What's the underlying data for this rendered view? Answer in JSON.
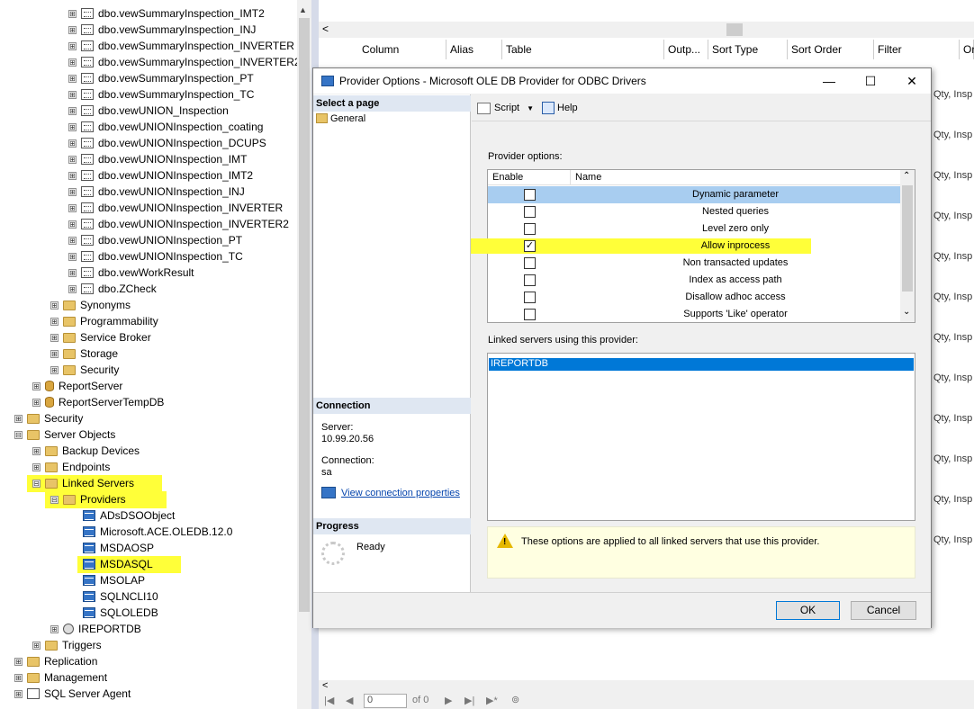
{
  "tree": {
    "views": [
      "dbo.vewSummaryInspection_IMT2",
      "dbo.vewSummaryInspection_INJ",
      "dbo.vewSummaryInspection_INVERTER",
      "dbo.vewSummaryInspection_INVERTER2",
      "dbo.vewSummaryInspection_PT",
      "dbo.vewSummaryInspection_TC",
      "dbo.vewUNION_Inspection",
      "dbo.vewUNIONInspection_coating",
      "dbo.vewUNIONInspection_DCUPS",
      "dbo.vewUNIONInspection_IMT",
      "dbo.vewUNIONInspection_IMT2",
      "dbo.vewUNIONInspection_INJ",
      "dbo.vewUNIONInspection_INVERTER",
      "dbo.vewUNIONInspection_INVERTER2",
      "dbo.vewUNIONInspection_PT",
      "dbo.vewUNIONInspection_TC",
      "dbo.vewWorkResult",
      "dbo.ZCheck"
    ],
    "db_folders": [
      "Synonyms",
      "Programmability",
      "Service Broker",
      "Storage",
      "Security"
    ],
    "databases": [
      "ReportServer",
      "ReportServerTempDB"
    ],
    "security": "Security",
    "server_objects": "Server Objects",
    "backup_devices": "Backup Devices",
    "endpoints": "Endpoints",
    "linked_servers": "Linked Servers",
    "providers": "Providers",
    "provider_list": [
      "ADsDSOObject",
      "Microsoft.ACE.OLEDB.12.0",
      "MSDAOSP",
      "MSDASQL",
      "MSOLAP",
      "SQLNCLI10",
      "SQLOLEDB"
    ],
    "ireportdb": "IREPORTDB",
    "triggers": "Triggers",
    "replication": "Replication",
    "management": "Management",
    "agent": "SQL Server Agent",
    "expand_glyph": "⊞",
    "collapse_glyph": "⊟"
  },
  "grid": {
    "left_arrow": "<",
    "headers": [
      "Column",
      "Alias",
      "Table",
      "Outp...",
      "Sort Type",
      "Sort Order",
      "Filter",
      "Or"
    ],
    "row_text": "Qty, Insp",
    "nav": {
      "page": "0",
      "of": "of 0"
    }
  },
  "dialog": {
    "title": "Provider Options - Microsoft OLE DB Provider for ODBC Drivers",
    "min": "—",
    "max": "☐",
    "close": "✕",
    "select_page": "Select a page",
    "general": "General",
    "script": "Script",
    "help": "Help",
    "connection_hdr": "Connection",
    "server_label": "Server:",
    "server_value": "10.99.20.56",
    "connection_label": "Connection:",
    "connection_value": "sa",
    "view_conn": "View connection properties",
    "progress_hdr": "Progress",
    "ready": "Ready",
    "provider_options_label": "Provider options:",
    "col_enable": "Enable",
    "col_name": "Name",
    "options": [
      {
        "name": "Dynamic parameter",
        "checked": false
      },
      {
        "name": "Nested queries",
        "checked": false
      },
      {
        "name": "Level zero only",
        "checked": false
      },
      {
        "name": "Allow inprocess",
        "checked": true
      },
      {
        "name": "Non transacted updates",
        "checked": false
      },
      {
        "name": "Index as access path",
        "checked": false
      },
      {
        "name": "Disallow adhoc access",
        "checked": false
      },
      {
        "name": "Supports 'Like' operator",
        "checked": false
      }
    ],
    "linked_label": "Linked servers using this provider:",
    "linked_servers": [
      "IREPORTDB"
    ],
    "note": "These options are applied to all linked servers that use this provider.",
    "ok": "OK",
    "cancel": "Cancel"
  },
  "colors": {
    "highlight": "#ffff39",
    "selection": "#0078d7",
    "row_select": "#a8cdf0"
  }
}
